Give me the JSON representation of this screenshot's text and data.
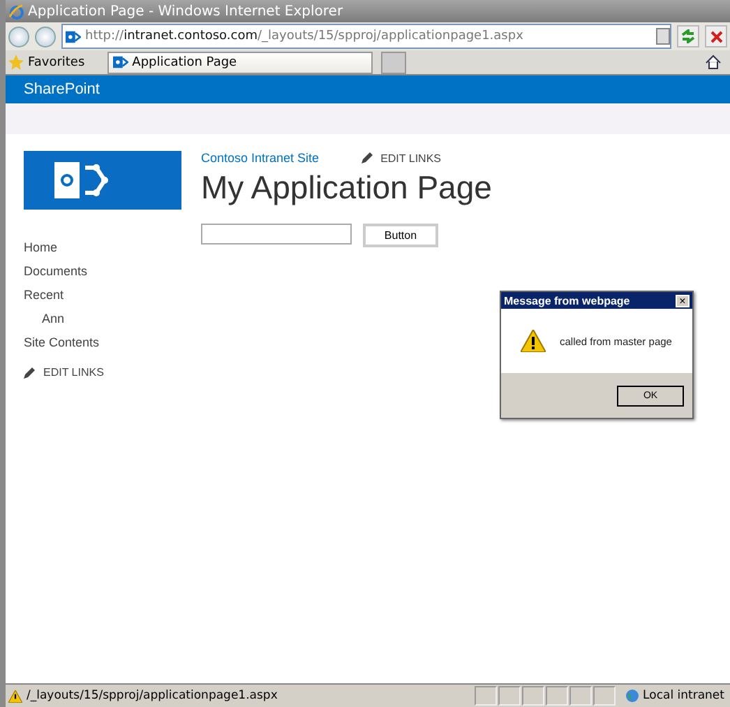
{
  "window": {
    "title": "Application Page - Windows Internet Explorer"
  },
  "address_bar": {
    "url": "http://**intranet.contoso.com**/_layouts/15/spproj/applicationpage1.aspx"
  },
  "favorites": {
    "label": "Favorites"
  },
  "tabs": [
    {
      "label": "Application Page",
      "selected": true
    }
  ],
  "suite_bar": {
    "title": "SharePoint"
  },
  "site": {
    "link": "Contoso Intranet Site",
    "edit_links": "EDIT LINKS",
    "page_title": "My Application Page"
  },
  "nav": {
    "items": [
      {
        "label": "Home"
      },
      {
        "label": "Documents"
      },
      {
        "label": "Recent",
        "children": [
          {
            "label": "Ann"
          }
        ]
      },
      {
        "label": "Site Contents"
      }
    ],
    "edit_links": "EDIT LINKS"
  },
  "form": {
    "button": "Button"
  },
  "dialog": {
    "title": "Message from webpage",
    "close": "×",
    "message": "called from master page",
    "button": "OK"
  },
  "status_bar": {
    "text": "/_layouts/15/spproj/applicationpage1.aspx",
    "zone": "Local intranet"
  }
}
